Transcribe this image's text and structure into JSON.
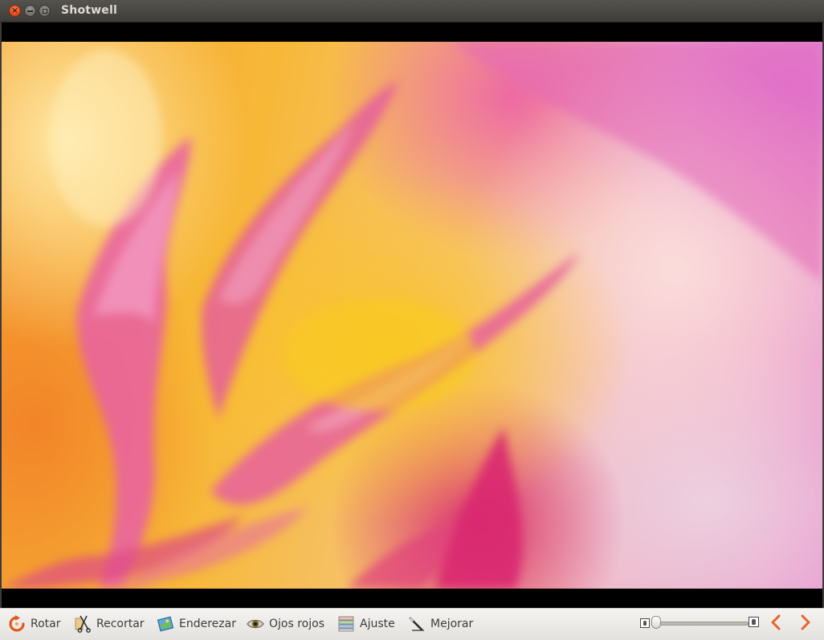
{
  "window": {
    "title": "Shotwell"
  },
  "viewer": {
    "photo_description_icon": "photo"
  },
  "toolbar": {
    "tools": [
      {
        "id": "rotate",
        "label": "Rotar",
        "icon": "rotate-icon"
      },
      {
        "id": "crop",
        "label": "Recortar",
        "icon": "crop-icon"
      },
      {
        "id": "straighten",
        "label": "Enderezar",
        "icon": "straighten-icon"
      },
      {
        "id": "redeye",
        "label": "Ojos rojos",
        "icon": "eye-icon"
      },
      {
        "id": "adjust",
        "label": "Ajuste",
        "icon": "adjust-icon"
      },
      {
        "id": "enhance",
        "label": "Mejorar",
        "icon": "enhance-icon"
      }
    ],
    "zoom": {
      "value": 0.0
    },
    "nav": {
      "previous_icon": "chevron-left-icon",
      "next_icon": "chevron-right-icon"
    }
  },
  "colors": {
    "accent_orange": "#e8632a",
    "titlebar": "#3e3d39",
    "toolbar": "#ecebe8"
  }
}
